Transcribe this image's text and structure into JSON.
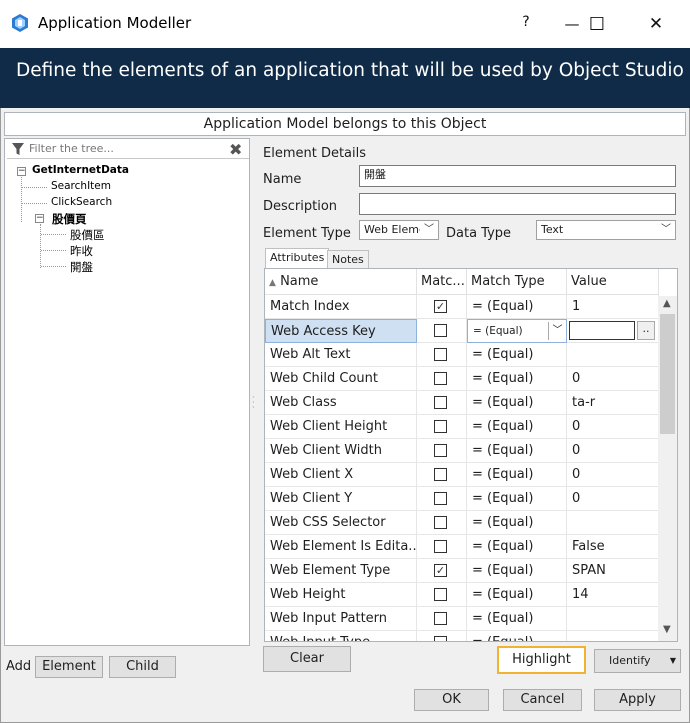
{
  "window": {
    "title": "Application Modeller",
    "help_glyph": "?",
    "minimize_glyph": "—",
    "maximize_glyph": "☐",
    "close_glyph": "✕"
  },
  "banner": {
    "text": "Define the elements of an application that will be used by Object Studio"
  },
  "belongs_bar": {
    "text": "Application Model belongs to this Object"
  },
  "tree": {
    "filter_placeholder": "Filter the tree...",
    "clear_glyph": "✖",
    "root": "GetInternetData",
    "children": [
      "SearchItem",
      "ClickSearch"
    ],
    "group": "股價頁",
    "group_children": [
      "股價區",
      "昨收",
      "開盤"
    ],
    "collapse_glyph": "−"
  },
  "details": {
    "section_title": "Element Details",
    "name_label": "Name",
    "name_value": "開盤",
    "description_label": "Description",
    "description_value": "",
    "element_type_label": "Element Type",
    "element_type_value": "Web Element",
    "data_type_label": "Data Type",
    "data_type_value": "Text"
  },
  "tabs": [
    {
      "label": "Attributes"
    },
    {
      "label": "Notes"
    }
  ],
  "grid": {
    "headers": [
      "Name",
      "Matc...",
      "Match Type",
      "Value"
    ],
    "sort_glyph": "▲",
    "rows": [
      {
        "name": "Match Index",
        "match": true,
        "type": "=  (Equal)",
        "value": "1"
      },
      {
        "name": "Web Access Key",
        "match": false,
        "type": "=  (Equal)",
        "value": ""
      },
      {
        "name": "Web Alt Text",
        "match": false,
        "type": "=  (Equal)",
        "value": ""
      },
      {
        "name": "Web Child Count",
        "match": false,
        "type": "=  (Equal)",
        "value": "0"
      },
      {
        "name": "Web Class",
        "match": false,
        "type": "=  (Equal)",
        "value": " ta-r"
      },
      {
        "name": "Web Client Height",
        "match": false,
        "type": "=  (Equal)",
        "value": "0"
      },
      {
        "name": "Web Client Width",
        "match": false,
        "type": "=  (Equal)",
        "value": "0"
      },
      {
        "name": "Web Client X",
        "match": false,
        "type": "=  (Equal)",
        "value": "0"
      },
      {
        "name": "Web Client Y",
        "match": false,
        "type": "=  (Equal)",
        "value": "0"
      },
      {
        "name": "Web CSS Selector",
        "match": false,
        "type": "=  (Equal)",
        "value": ""
      },
      {
        "name": "Web Element Is Edita...",
        "match": false,
        "type": "=  (Equal)",
        "value": "False"
      },
      {
        "name": "Web Element Type",
        "match": true,
        "type": "=  (Equal)",
        "value": "SPAN"
      },
      {
        "name": "Web Height",
        "match": false,
        "type": "=  (Equal)",
        "value": "14"
      },
      {
        "name": "Web Input Pattern",
        "match": false,
        "type": "=  (Equal)",
        "value": ""
      },
      {
        "name": "Web Input Type",
        "match": false,
        "type": "=  (Equal)",
        "value": ""
      }
    ],
    "selected_row": 1,
    "editor_button": "..",
    "scroll_up": "▲",
    "scroll_down": "▼"
  },
  "add_bar": {
    "label": "Add",
    "element_button": "Element",
    "child_button": "Child"
  },
  "actions": {
    "clear": "Clear",
    "highlight": "Highlight",
    "identify": "Identify",
    "ok": "OK",
    "cancel": "Cancel",
    "apply": "Apply"
  },
  "colors": {
    "banner": "#0f2b47",
    "selection": "#cfe0f3",
    "highlight_border": "#f2b330"
  }
}
